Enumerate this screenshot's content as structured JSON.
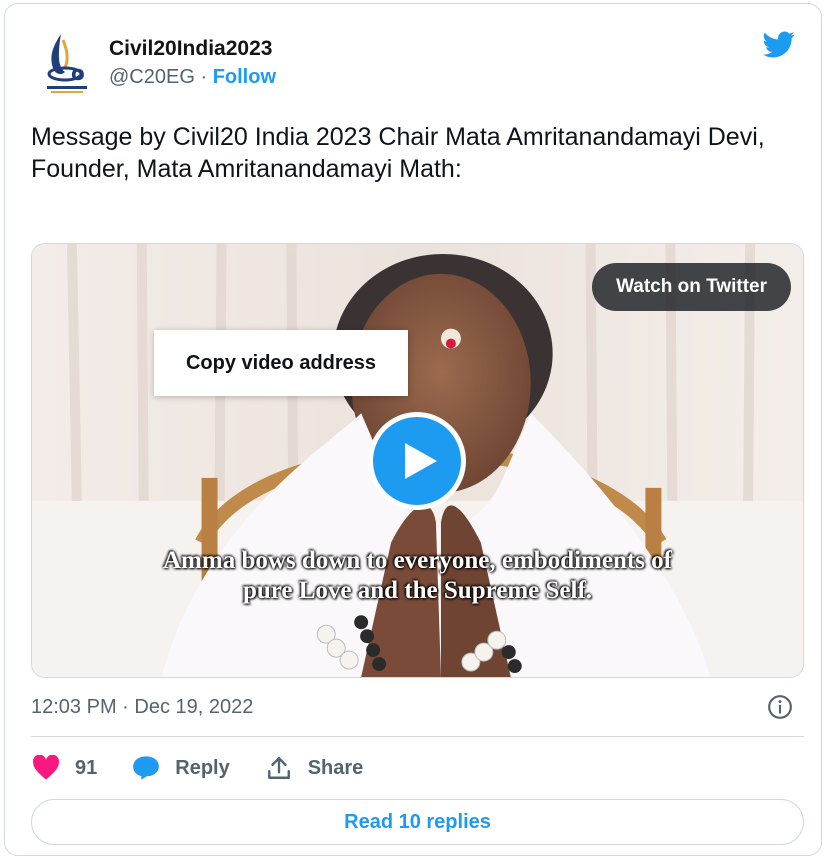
{
  "author": {
    "name": "Civil20India2023",
    "handle": "@C20EG",
    "separator": "·",
    "follow_label": "Follow"
  },
  "tweet": {
    "text": "Message by Civil20 India 2023 Chair Mata Amritanandamayi Devi, Founder, Mata Amritanandamayi Math:",
    "timestamp": "12:03 PM · Dec 19, 2022"
  },
  "media": {
    "watch_label": "Watch on Twitter",
    "copy_label": "Copy video address",
    "caption_line1": "Amma bows down to everyone, embodiments of",
    "caption_line2": "pure Love and the Supreme Self."
  },
  "actions": {
    "like_count": "91",
    "reply_label": "Reply",
    "share_label": "Share"
  },
  "read_replies_label": "Read 10 replies",
  "icons": {
    "brand": "twitter-bird-icon",
    "like": "heart-icon",
    "reply": "speech-bubble-icon",
    "share": "share-upload-icon",
    "info": "info-icon",
    "play": "play-icon"
  },
  "colors": {
    "accent": "#1d9bf0",
    "like": "#f91880",
    "text": "#0f1419",
    "muted": "#536471",
    "border": "#cfd9de"
  }
}
